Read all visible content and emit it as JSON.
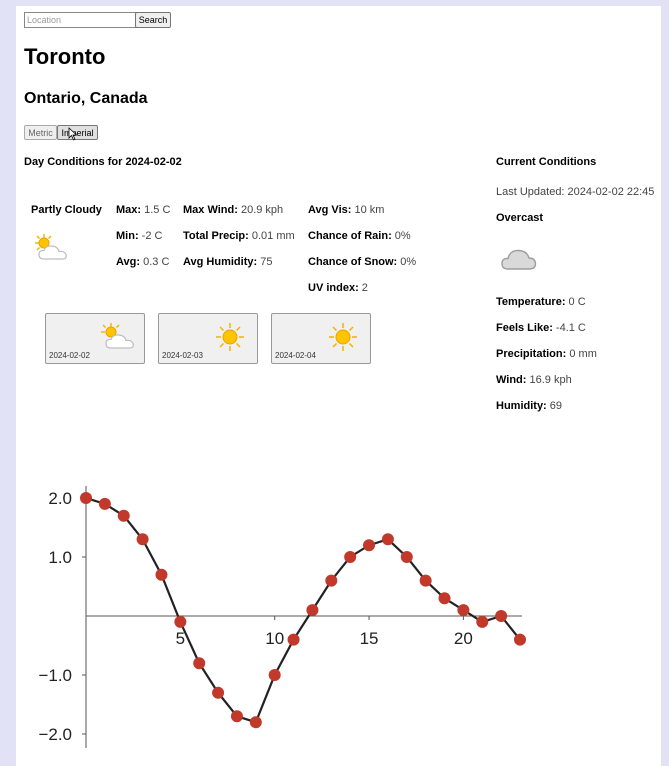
{
  "search": {
    "placeholder": "Location",
    "button_label": "Search"
  },
  "location": {
    "city": "Toronto",
    "region": "Ontario, Canada"
  },
  "units": {
    "metric_label": "Metric",
    "imperial_label": "Imperial"
  },
  "day_conditions": {
    "title": "Day Conditions for 2024-02-02",
    "summary": "Partly Cloudy",
    "icon": "partly-cloudy-icon",
    "max_label": "Max:",
    "max_value": "1.5 C",
    "min_label": "Min:",
    "min_value": "-2 C",
    "avg_label": "Avg:",
    "avg_value": "0.3 C",
    "max_wind_label": "Max Wind:",
    "max_wind_value": "20.9 kph",
    "total_precip_label": "Total Precip:",
    "total_precip_value": "0.01 mm",
    "avg_humidity_label": "Avg Humidity:",
    "avg_humidity_value": "75",
    "avg_vis_label": "Avg Vis:",
    "avg_vis_value": "10 km",
    "rain_label": "Chance of Rain:",
    "rain_value": "0%",
    "snow_label": "Chance of Snow:",
    "snow_value": "0%",
    "uv_label": "UV index:",
    "uv_value": "2"
  },
  "forecast_days": [
    {
      "date": "2024-02-02",
      "icon": "partly-cloudy-icon"
    },
    {
      "date": "2024-02-03",
      "icon": "sunny-icon"
    },
    {
      "date": "2024-02-04",
      "icon": "sunny-icon"
    }
  ],
  "current": {
    "title": "Current Conditions",
    "updated": "Last Updated: 2024-02-02 22:45",
    "condition": "Overcast",
    "icon": "cloud-icon",
    "temp_label": "Temperature:",
    "temp_value": "0 C",
    "feels_label": "Feels Like:",
    "feels_value": "-4.1 C",
    "precip_label": "Precipitation:",
    "precip_value": "0 mm",
    "wind_label": "Wind:",
    "wind_value": "16.9 kph",
    "humidity_label": "Humidity:",
    "humidity_value": "69"
  },
  "colors": {
    "point": "#c0392b",
    "line": "#222222"
  },
  "chart_data": {
    "type": "line",
    "title": "",
    "xlabel": "",
    "ylabel": "",
    "x": [
      0,
      1,
      2,
      3,
      4,
      5,
      6,
      7,
      8,
      9,
      10,
      11,
      12,
      13,
      14,
      15,
      16,
      17,
      18,
      19,
      20,
      21,
      22,
      23
    ],
    "series": [
      {
        "values": [
          2.0,
          1.9,
          1.7,
          1.3,
          0.7,
          -0.1,
          -0.8,
          -1.3,
          -1.7,
          -1.8,
          -1.0,
          -0.4,
          0.1,
          0.6,
          1.0,
          1.2,
          1.3,
          1.0,
          0.6,
          0.3,
          0.1,
          -0.1,
          0.0,
          -0.4
        ]
      }
    ],
    "xticks": [
      5,
      10,
      15,
      20
    ],
    "yticks": [
      2.0,
      1.0,
      -1.0,
      -2.0
    ],
    "ytick_labels": [
      "2.0",
      "1.0",
      "−1.0",
      "−2.0"
    ],
    "xlim": [
      0,
      23
    ],
    "ylim": [
      -2.1,
      2.1
    ],
    "grid": false
  }
}
